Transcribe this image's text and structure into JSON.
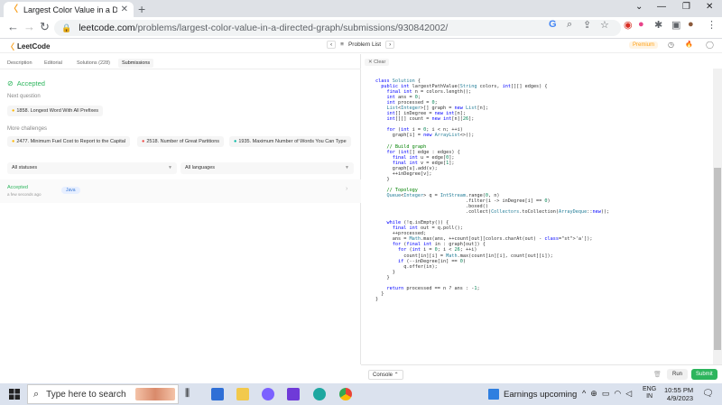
{
  "browser": {
    "tab_title": "Largest Color Value in a Directed",
    "tab_close": "✕",
    "new_tab": "+",
    "url_host": "leetcode.com",
    "url_path": "/problems/largest-color-value-in-a-directed-graph/submissions/930842002/",
    "window_controls": [
      "⌄",
      "—",
      "❐",
      "✕"
    ]
  },
  "header": {
    "logo": "LeetCode",
    "problem_list": "Problem List",
    "premium": "Premium"
  },
  "left": {
    "tabs": [
      "Description",
      "Editorial",
      "Solutions (228)",
      "Submissions"
    ],
    "status": "Accepted",
    "next_label": "Next question",
    "next_question": "1858. Longest Word With All Prefixes",
    "more_label": "More challenges",
    "challenges": [
      "2477. Minimum Fuel Cost to Report to the Capital",
      "2518. Number of Great Partitions",
      "1935. Maximum Number of Words You Can Type"
    ],
    "filter_status": "All statuses",
    "filter_lang": "All languages",
    "submission": {
      "status": "Accepted",
      "time": "a few seconds ago",
      "lang": "Java"
    }
  },
  "right": {
    "clear": "Clear",
    "console": "Console",
    "run": "Run",
    "submit": "Submit"
  },
  "taskbar": {
    "search_placeholder": "Type here to search",
    "weather": "Earnings upcoming",
    "lang_line1": "ENG",
    "lang_line2": "IN",
    "time": "10:55 PM",
    "date": "4/9/2023"
  },
  "colors": {
    "accent_orange": "#ffa116",
    "accepted_green": "#2db55d",
    "submit_green": "#2db55d"
  }
}
